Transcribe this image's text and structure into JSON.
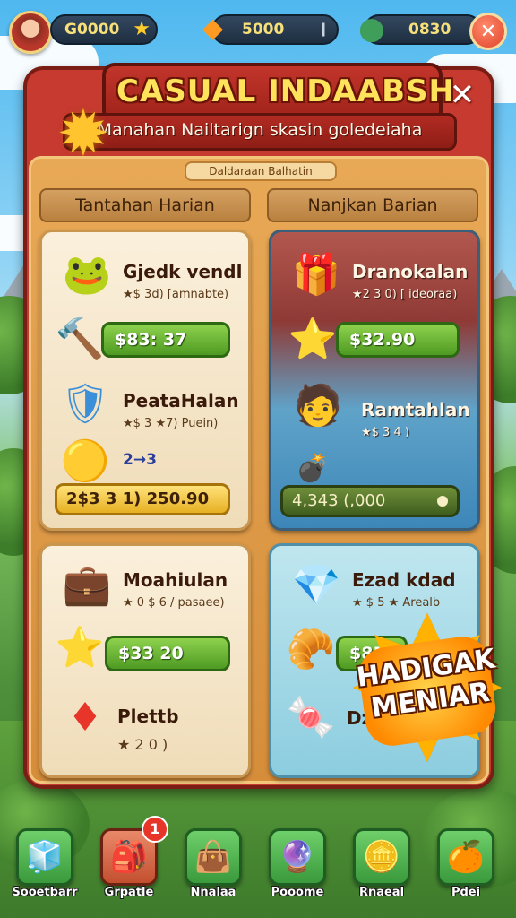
{
  "hud": {
    "currency_1": "G0000",
    "currency_2": "5000",
    "currency_3": "0830",
    "close_glyph": "✕"
  },
  "panel": {
    "title": "CASUAL INDAABSH",
    "subtitle": "Manahan Nailtarign skasin goledeiaha",
    "close_glyph": "✕",
    "label_strip": "Daldaraan Balhatin",
    "column_left": "Tantahan Harian",
    "column_right": "Nanjkan Barian"
  },
  "cards": {
    "c1": {
      "item1_name": "Gjedk vendl",
      "item1_sub": "★$ 3d) [amnabte)",
      "price1": "$83: 37",
      "item2_name": "PeataHalan",
      "item2_sub": "★$ 3 ★7) Puein)",
      "small": "2→3",
      "price2": "2$3 3 1) 250.90"
    },
    "c2": {
      "item1_name": "Dranokalan",
      "item1_sub": "★2 3 0) [ ideoraa)",
      "price1": "$32.90",
      "item2_name": "Ramtahlan",
      "item2_sub": "★$ 3 4 )",
      "price2": "4,343 (,000"
    },
    "c3": {
      "item1_name": "Moahiulan",
      "item1_sub": "★ 0 $ 6 / pasaee)",
      "price1": "$33 20",
      "item2_name": "Plettb",
      "item2_sub": "★ 2 0 )"
    },
    "c4": {
      "item1_name": "Ezad kdad",
      "item1_sub": "★ $ 5 ★ Arealb",
      "price1": "$85",
      "item2_name": "Dz"
    }
  },
  "burst": {
    "text": "HADIGAK MENIAR"
  },
  "nav": [
    {
      "label": "Sooetbarr",
      "icon": "chest-icon",
      "glyph": "🧊"
    },
    {
      "label": "Grpatle",
      "icon": "bag-icon",
      "glyph": "🎒",
      "badge": "1"
    },
    {
      "label": "Nnalaa",
      "icon": "backpack-icon",
      "glyph": "👜"
    },
    {
      "label": "Pooome",
      "icon": "potion-icon",
      "glyph": "🔮"
    },
    {
      "label": "Rnaeal",
      "icon": "coin-icon",
      "glyph": "🪙"
    },
    {
      "label": "Pdei",
      "icon": "fruit-icon",
      "glyph": "🍊"
    }
  ],
  "colors": {
    "panel_red": "#c63a2f",
    "inner_gold": "#e8a957",
    "button_green": "#6ab63a",
    "title_yellow": "#ffe25c"
  }
}
